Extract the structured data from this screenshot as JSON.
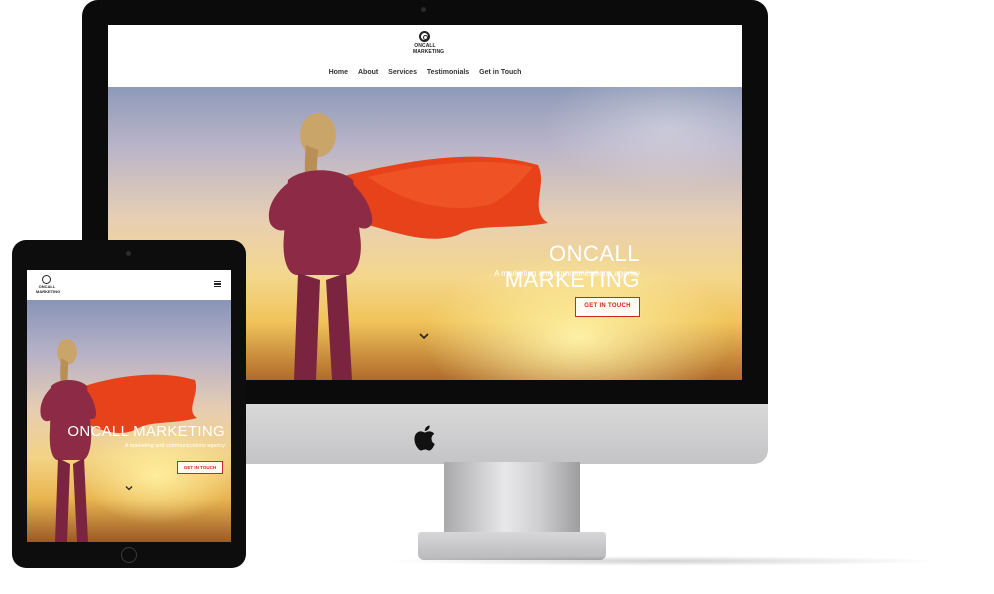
{
  "brand": {
    "line1": "ONCALL",
    "line2": "MARKETING"
  },
  "nav": {
    "items": [
      {
        "label": "Home"
      },
      {
        "label": "About"
      },
      {
        "label": "Services"
      },
      {
        "label": "Testimonials"
      },
      {
        "label": "Get in Touch"
      }
    ]
  },
  "hero": {
    "title": "ONCALL MARKETING",
    "subtitle": "A marketing and communications agency",
    "cta_label": "GET IN TOUCH",
    "scroll_icon": "chevron-down-icon"
  },
  "ipad": {
    "brand": {
      "line1": "ONCALL",
      "line2": "MARKETING"
    },
    "menu_icon": "hamburger-menu-icon",
    "hero": {
      "title": "ONCALL MARKETING",
      "subtitle": "A marketing and communications agency",
      "cta_label": "GET IN TOUCH"
    }
  },
  "colors": {
    "accent": "#d3241a",
    "device_frame": "#0b0b0c",
    "aluminum": "#c9c9cb",
    "cape": "#e8421b"
  }
}
